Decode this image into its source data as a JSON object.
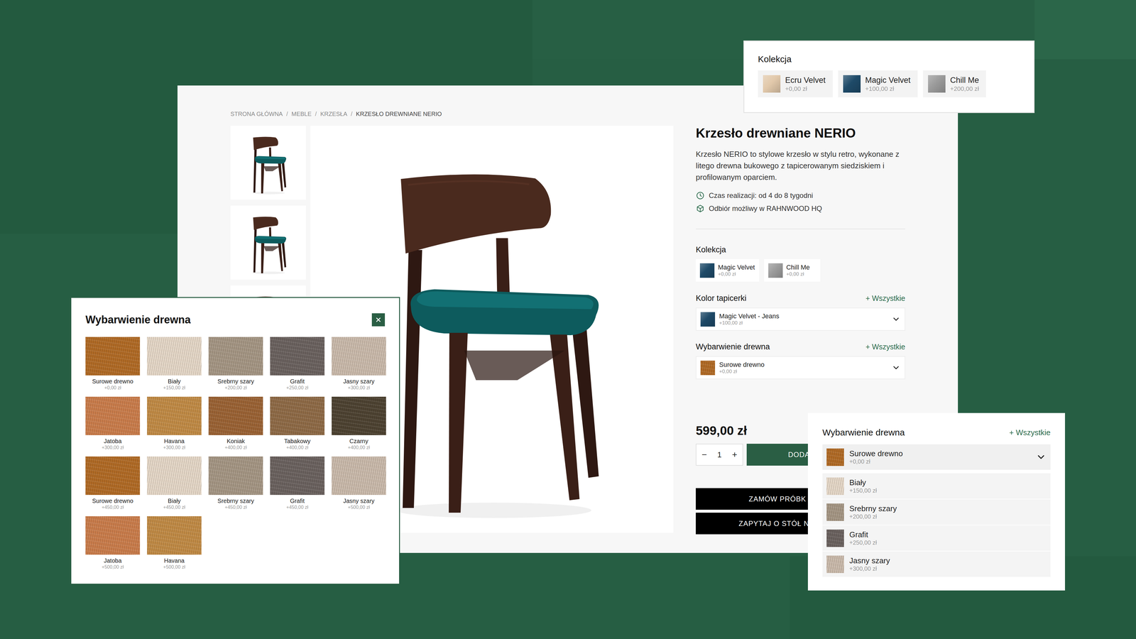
{
  "product": {
    "breadcrumb": [
      "STRONA GŁÓWNA",
      "MEBLE",
      "KRZESŁA",
      "KRZESŁO DREWNIANE NERIO"
    ],
    "breadcrumb_separator": "/",
    "title": "Krzesło drewniane NERIO",
    "description": "Krzesło NERIO to stylowe krzesło w stylu retro, wykonane z litego drewna bukowego z tapicerowanym siedziskiem i profilowanym oparciem.",
    "info": [
      {
        "text": "Czas realizacji: od 4 do 8 tygodni",
        "kind": "clock"
      },
      {
        "text": "Odbiór możliwy w RAHNWOOD HQ",
        "kind": "box"
      }
    ],
    "collection": {
      "label": "Kolekcja",
      "options": [
        {
          "name": "Magic Velvet",
          "price": "+0,00 zł",
          "color": "#1e4a68"
        },
        {
          "name": "Chill Me",
          "price": "+0,00 zł",
          "color": "#9b9b9b"
        }
      ]
    },
    "upholstery": {
      "label": "Kolor tapicerki",
      "all_link": "+ Wszystkie",
      "selected": {
        "name": "Magic Velvet - Jeans",
        "price": "+100,00 zł",
        "color": "#1d4866"
      }
    },
    "wood": {
      "label": "Wybarwienie drewna",
      "all_link": "+ Wszystkie",
      "selected": {
        "name": "Surowe drewno",
        "price": "+0,00 zł",
        "color": "#b06a25"
      }
    },
    "price": "599,00 zł",
    "qty_minus": "−",
    "quantity": "1",
    "qty_plus": "+",
    "add_button": "DODA",
    "sample_button": "ZAMÓW PRÓBK",
    "table_button": "ZAPYTAJ O STÓŁ N"
  },
  "collection_popup": {
    "label": "Kolekcja",
    "options": [
      {
        "name": "Ecru Velvet",
        "price": "+0,00 zł",
        "color": "#e2c9ab"
      },
      {
        "name": "Magic Velvet",
        "price": "+100,00 zł",
        "color": "#1e4a68"
      },
      {
        "name": "Chill Me",
        "price": "+200,00 zł",
        "color": "#9b9b9b"
      }
    ]
  },
  "wood_modal": {
    "title": "Wybarwienie drewna",
    "options": [
      {
        "name": "Surowe drewno",
        "price": "+0,00 zł",
        "color": "#b06a25"
      },
      {
        "name": "Biały",
        "price": "+150,00 zł",
        "color": "#e4d6c6"
      },
      {
        "name": "Srebrny szary",
        "price": "+200,00 zł",
        "color": "#a49583"
      },
      {
        "name": "Grafit",
        "price": "+250,00 zł",
        "color": "#6a615e"
      },
      {
        "name": "Jasny szary",
        "price": "+300,00 zł",
        "color": "#c9b9aa"
      },
      {
        "name": "Jatoba",
        "price": "+300,00 zł",
        "color": "#c97c4b"
      },
      {
        "name": "Havana",
        "price": "+300,00 zł",
        "color": "#c08a45"
      },
      {
        "name": "Koniak",
        "price": "+400,00 zł",
        "color": "#9a6234"
      },
      {
        "name": "Tabakowy",
        "price": "+400,00 zł",
        "color": "#8e6a46"
      },
      {
        "name": "Czarny",
        "price": "+400,00 zł",
        "color": "#4d4231"
      },
      {
        "name": "Surowe drewno",
        "price": "+450,00 zł",
        "color": "#b06a25"
      },
      {
        "name": "Biały",
        "price": "+450,00 zł",
        "color": "#e4d6c6"
      },
      {
        "name": "Srebrny szary",
        "price": "+450,00 zł",
        "color": "#a49583"
      },
      {
        "name": "Grafit",
        "price": "+450,00 zł",
        "color": "#6a615e"
      },
      {
        "name": "Jasny szary",
        "price": "+500,00 zł",
        "color": "#c9b9aa"
      },
      {
        "name": "Jatoba",
        "price": "+500,00 zł",
        "color": "#c97c4b"
      },
      {
        "name": "Havana",
        "price": "+500,00 zł",
        "color": "#c08a45"
      }
    ]
  },
  "wood_dropdown": {
    "label": "Wybarwienie drewna",
    "all_link": "+ Wszystkie",
    "selected": {
      "name": "Surowe drewno",
      "price": "+0,00 zł",
      "color": "#b06a25"
    },
    "options": [
      {
        "name": "Biały",
        "price": "+150,00 zł",
        "color": "#e4d6c6"
      },
      {
        "name": "Srebrny szary",
        "price": "+200,00 zł",
        "color": "#a49583"
      },
      {
        "name": "Grafit",
        "price": "+250,00 zł",
        "color": "#6a615e"
      },
      {
        "name": "Jasny szary",
        "price": "+300,00 zł",
        "color": "#c9b9aa"
      }
    ]
  }
}
